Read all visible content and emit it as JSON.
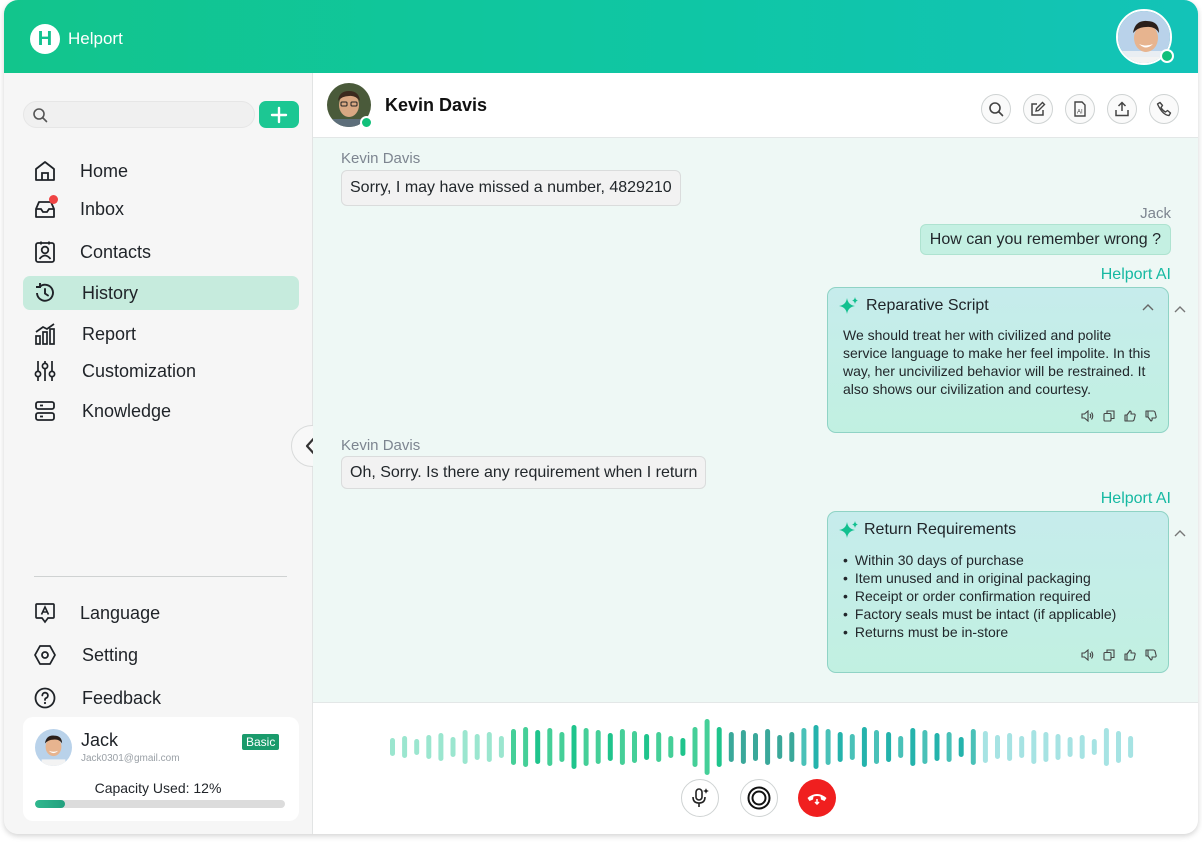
{
  "app": {
    "name": "Helport",
    "logo_letter": "H"
  },
  "colors": {
    "brand": "#13c28f",
    "active_nav": "#c6ebdd",
    "hangup": "#f01f1f",
    "ai_label": "#16b9a2"
  },
  "sidebar": {
    "search_placeholder": "",
    "nav": [
      {
        "label": "Home",
        "icon": "home-icon"
      },
      {
        "label": "Inbox",
        "icon": "inbox-icon",
        "has_notification": true
      },
      {
        "label": "Contacts",
        "icon": "contacts-icon"
      },
      {
        "label": "History",
        "icon": "history-icon",
        "active": true
      },
      {
        "label": "Report",
        "icon": "report-icon"
      },
      {
        "label": "Customization",
        "icon": "sliders-icon"
      },
      {
        "label": "Knowledge",
        "icon": "knowledge-icon"
      }
    ],
    "bottom_nav": [
      {
        "label": "Language",
        "icon": "language-icon"
      },
      {
        "label": "Setting",
        "icon": "settings-icon"
      },
      {
        "label": "Feedback",
        "icon": "help-icon"
      }
    ],
    "user": {
      "name": "Jack",
      "email": "Jack0301@gmail.com",
      "plan": "Basic",
      "capacity_label": "Capacity Used: 12%",
      "capacity_used": 0.12
    }
  },
  "chat": {
    "contact_name": "Kevin Davis",
    "header_icons": [
      "search-icon",
      "edit-icon",
      "ai-document-icon",
      "share-icon",
      "phone-icon"
    ],
    "messages": [
      {
        "sender": "Kevin Davis",
        "text": "Sorry, I may have missed a number, 4829210"
      },
      {
        "sender": "Jack",
        "text": "How can you remember wrong ?"
      },
      {
        "sender": "Helport AI",
        "card_title": "Reparative Script",
        "card_text": "We should treat her with civilized and polite service language to make her feel impolite. In this way, her uncivilized behavior will be restrained. It also shows our civilization and courtesy."
      },
      {
        "sender": "Kevin Davis",
        "text": "Oh, Sorry. Is there any requirement when I return"
      },
      {
        "sender": "Helport AI",
        "card_title": "Return Requirements",
        "card_items": [
          "Within 30 days of purchase",
          "Item unused and in original packaging",
          "Receipt or order confirmation required",
          "Factory seals must be intact (if applicable)",
          "Returns must be in-store"
        ]
      }
    ]
  },
  "call": {
    "controls": [
      "ai-mic-icon",
      "record-icon",
      "hangup-icon"
    ]
  }
}
